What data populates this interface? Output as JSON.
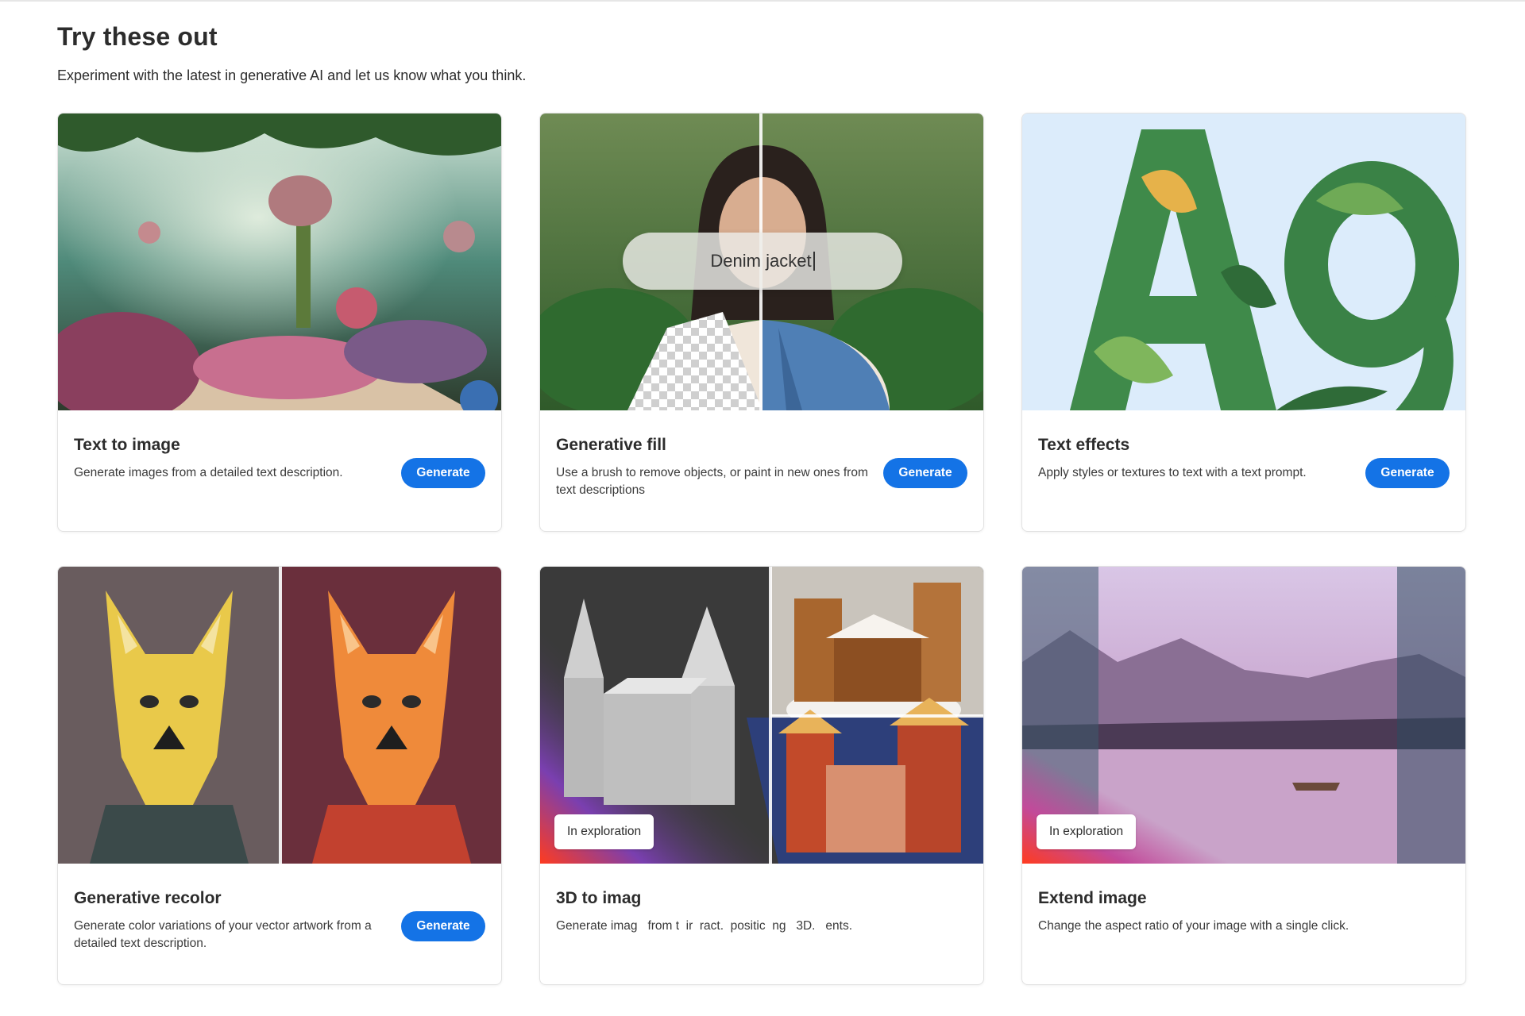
{
  "page": {
    "title": "Try these out",
    "subtitle": "Experiment with the latest in generative AI and let us know what you think."
  },
  "cards": [
    {
      "title": "Text to image",
      "description": "Generate images from a detailed text description.",
      "button": "Generate",
      "image": "fantasy-garden-illustration"
    },
    {
      "title": "Generative fill",
      "description": "Use a brush to remove objects, or paint in new ones from text descriptions",
      "button": "Generate",
      "image": "portrait-denim-jacket",
      "prompt_text": "Denim jacket"
    },
    {
      "title": "Text effects",
      "description": "Apply styles or textures to text with a text prompt.",
      "button": "Generate",
      "image": "leafy-letters-ag"
    },
    {
      "title": "Generative recolor",
      "description": "Generate color variations of your vector artwork from a detailed text description.",
      "button": "Generate",
      "image": "geometric-dog-recolor"
    },
    {
      "title": "3D to imag",
      "description": "Generate imag   from t  ir  ract.  positic  ng   3D.   ents.",
      "badge": "In exploration",
      "image": "3d-castle-to-image"
    },
    {
      "title": "Extend image",
      "description": "Change the aspect ratio of your image with a single click.",
      "badge": "In exploration",
      "image": "lake-landscape-extend"
    }
  ],
  "colors": {
    "accent": "#1473e6",
    "text": "#2c2c2c",
    "border": "#e2e2e2"
  }
}
